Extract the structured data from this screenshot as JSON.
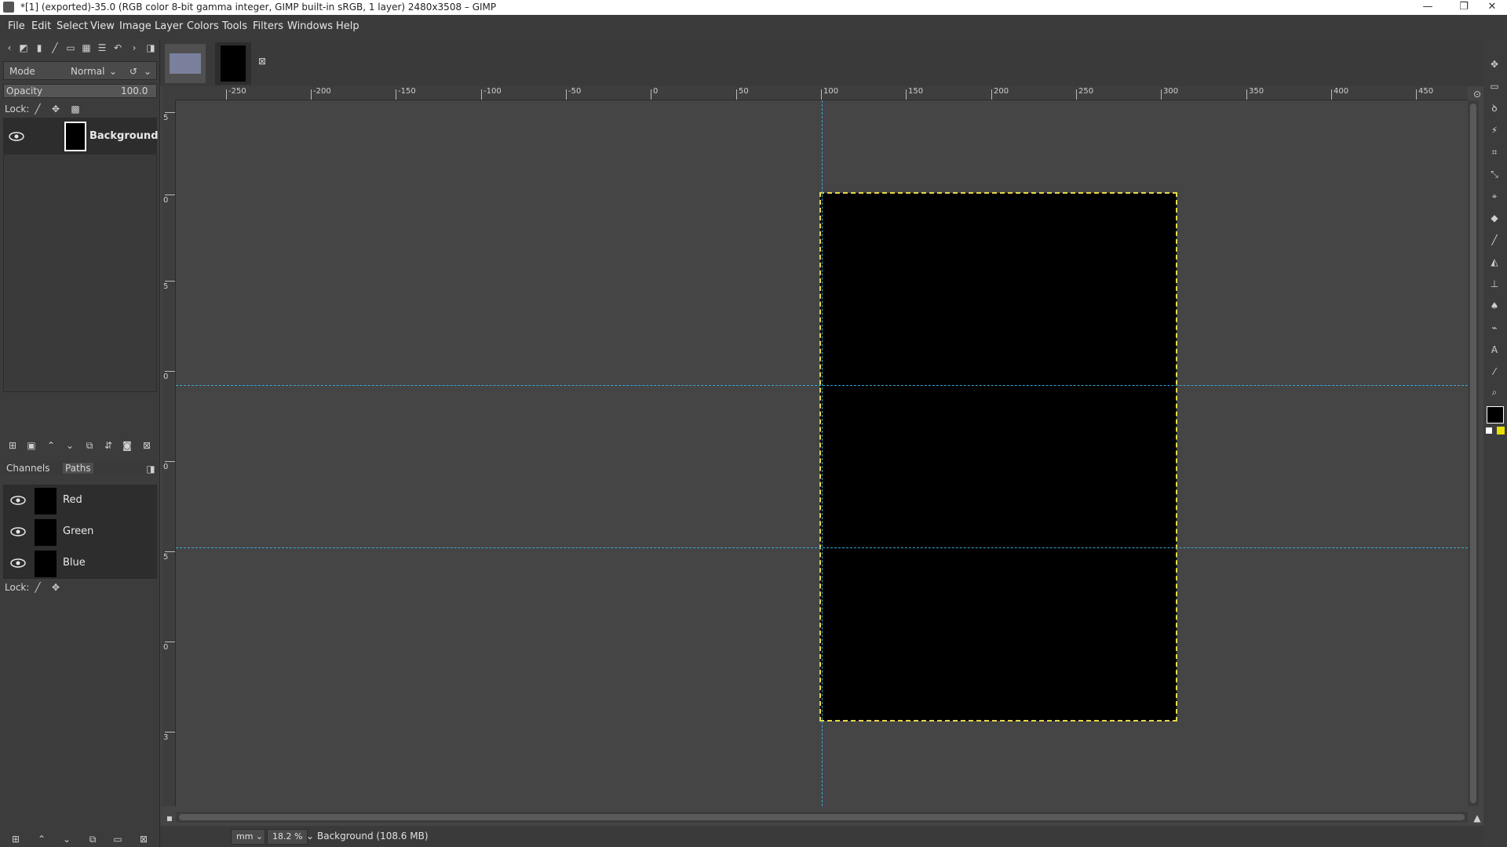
{
  "window": {
    "title": "*[1] (exported)-35.0 (RGB color 8-bit gamma integer, GIMP built-in sRGB, 1 layer) 2480x3508 – GIMP",
    "minimize": "—",
    "restore": "❐",
    "close": "✕"
  },
  "menu": [
    "File",
    "Edit",
    "Select",
    "View",
    "Image",
    "Layer",
    "Colors",
    "Tools",
    "Filters",
    "Windows",
    "Help"
  ],
  "layers_panel": {
    "mode_label": "Mode",
    "mode_value": "Normal",
    "opacity_label": "Opacity",
    "opacity_value": "100.0",
    "lock_label": "Lock:",
    "layers": [
      {
        "name": "Background"
      }
    ]
  },
  "channels_panel": {
    "tab_channels": "Channels",
    "tab_paths": "Paths",
    "channels": [
      {
        "name": "Red"
      },
      {
        "name": "Green"
      },
      {
        "name": "Blue"
      }
    ],
    "lock_label": "Lock:"
  },
  "rulers": {
    "horizontal_ticks": [
      "-250",
      "-200",
      "-150",
      "-100",
      "-50",
      "0",
      "50",
      "100",
      "150",
      "200",
      "250",
      "300",
      "350",
      "400",
      "450"
    ],
    "vertical_ticks": [
      "5",
      "0",
      "5",
      "0",
      "0",
      "5",
      "0",
      "3"
    ]
  },
  "status": {
    "unit": "mm",
    "zoom": "18.2 %",
    "info": "Background (108.6 MB)"
  },
  "colors": {
    "guide": "#3aa7d8",
    "selection": "#e8d84a",
    "foreground": "#000000",
    "background": "#ffffff",
    "accent_small": "#e8e000"
  }
}
